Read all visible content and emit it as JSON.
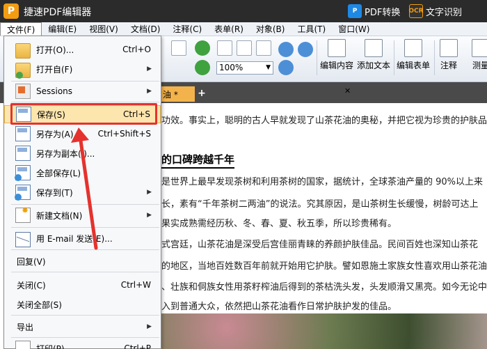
{
  "titlebar": {
    "logo": "P",
    "title": "捷速PDF编辑器",
    "pdf_convert_icon": "P",
    "pdf_convert": "PDF转换",
    "ocr_icon": "OCR",
    "ocr": "文字识别"
  },
  "menubar": [
    "文件(F)",
    "编辑(E)",
    "视图(V)",
    "文档(D)",
    "注释(C)",
    "表单(R)",
    "对象(B)",
    "工具(T)",
    "窗口(W)"
  ],
  "toolbar": {
    "zoom_value": "100%",
    "edit_content": "编辑内容",
    "add_text": "添加文本",
    "edit_form": "编辑表单",
    "annotate": "注释",
    "measure": "测量"
  },
  "tab": {
    "label": "油 *",
    "close": "✕",
    "add": "+"
  },
  "document": {
    "lines": [
      "功效。事实上，聪明的古人早就发现了山茶花油的奥秘，并把它视为珍贵的护肤品",
      "是世界上最早发现茶树和利用茶树的国家，据统计，全球茶油产量的 90%以上来",
      "长，素有“千年茶树二两油”的说法。究其原因，是山茶树生长缓慢，树龄可达上",
      "果实成熟需经历秋、冬、春、夏、秋五季，所以珍贵稀有。",
      "式宫廷，山茶花油是深受后宫佳丽青睐的养颜护肤佳品。民间百姓也深知山茶花",
      "的地区，当地百姓数百年前就开始用它护肤。譬如恩施土家族女性喜欢用山茶花油",
      "、壮族和侗族女性用茶籽榨油后得到的茶枯洗头发，头发顺滑又黑亮。如今无论中",
      "入到普通大众，依然把山茶花油看作日常护肤护发的佳品。"
    ],
    "heading": "的口碑跨越千年"
  },
  "file_menu": {
    "items": [
      {
        "label": "打开(O)...",
        "shortcut": "Ctrl+O"
      },
      {
        "label": "打开自(F)",
        "shortcut": ""
      },
      {
        "label": "Sessions",
        "shortcut": ""
      },
      {
        "label": "保存(S)",
        "shortcut": "Ctrl+S"
      },
      {
        "label": "另存为(A)...",
        "shortcut": "Ctrl+Shift+S"
      },
      {
        "label": "另存为副本(I)...",
        "shortcut": ""
      },
      {
        "label": "全部保存(L)",
        "shortcut": ""
      },
      {
        "label": "保存到(T)",
        "shortcut": ""
      },
      {
        "label": "新建文档(N)",
        "shortcut": ""
      },
      {
        "label": "用 E-mail 发送(E)...",
        "shortcut": ""
      },
      {
        "label": "回复(V)",
        "shortcut": ""
      },
      {
        "label": "关闭(C)",
        "shortcut": "Ctrl+W"
      },
      {
        "label": "关闭全部(S)",
        "shortcut": ""
      },
      {
        "label": "导出",
        "shortcut": ""
      },
      {
        "label": "打印(P)...",
        "shortcut": "Ctrl+P"
      }
    ],
    "submenu_arrow": "▶"
  },
  "colors": {
    "highlight": "#fde6ae",
    "annotation_red": "#e5322d",
    "titlebar": "#2b2b2b",
    "tab_active": "#f3b34c"
  }
}
